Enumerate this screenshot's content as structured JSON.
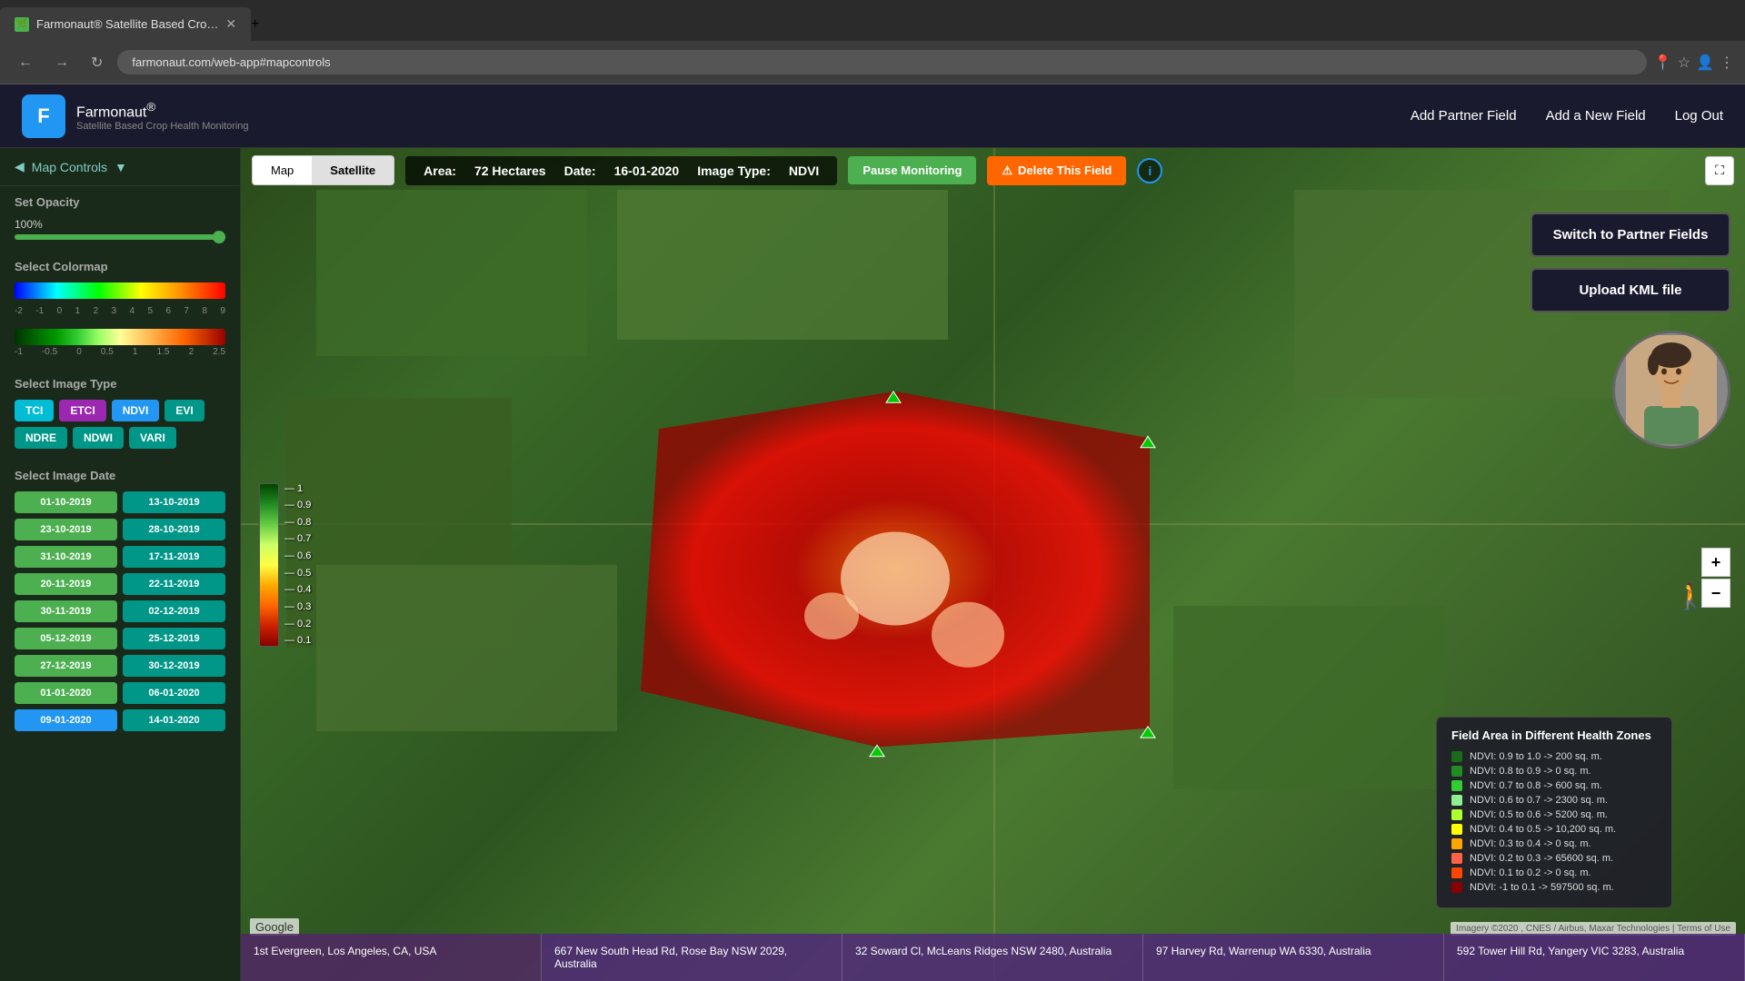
{
  "browser": {
    "tab_title": "Farmonaut® Satellite Based Cro…",
    "url": "farmonaut.com/web-app#mapcontrols",
    "new_tab_label": "+"
  },
  "header": {
    "logo_letter": "F",
    "app_name": "Farmonaut",
    "registered": "®",
    "tagline": "Satellite Based Crop Health Monitoring",
    "add_partner_label": "Add Partner Field",
    "add_field_label": "Add a New Field",
    "logout_label": "Log Out"
  },
  "sidebar": {
    "map_controls_label": "Map Controls",
    "opacity_label": "Set Opacity",
    "opacity_value": "100%",
    "opacity_percent": 100,
    "colormap_label": "Select Colormap",
    "colormap_scale_values": [
      "-2",
      "-1",
      "0",
      "1",
      "2",
      "3",
      "4",
      "5",
      "6",
      "7",
      "8",
      "9"
    ],
    "colormap2_scale_values": [
      "-1",
      "0.5",
      "0",
      "0.5",
      "1",
      "1.5",
      "2",
      "2.5"
    ],
    "image_type_label": "Select Image Type",
    "image_types": [
      {
        "id": "tci",
        "label": "TCI",
        "color": "cyan"
      },
      {
        "id": "etci",
        "label": "ETCI",
        "color": "purple",
        "active": true
      },
      {
        "id": "ndvi",
        "label": "NDVI",
        "color": "blue"
      },
      {
        "id": "evi",
        "label": "EVI",
        "color": "teal"
      },
      {
        "id": "ndre",
        "label": "NDRE",
        "color": "teal"
      },
      {
        "id": "ndwi",
        "label": "NDWI",
        "color": "teal"
      },
      {
        "id": "vari",
        "label": "VARI",
        "color": "teal"
      }
    ],
    "date_label": "Select Image Date",
    "dates": [
      "01-10-2019",
      "13-10-2019",
      "23-10-2019",
      "28-10-2019",
      "31-10-2019",
      "17-11-2019",
      "20-11-2019",
      "22-11-2019",
      "30-11-2019",
      "02-12-2019",
      "05-12-2019",
      "25-12-2019",
      "27-12-2019",
      "30-12-2019",
      "01-01-2020",
      "06-01-2020",
      "09-01-2020",
      "14-01-2020"
    ]
  },
  "map": {
    "type_map": "Map",
    "type_satellite": "Satellite",
    "active_type": "Satellite",
    "area_label": "Area:",
    "area_value": "72 Hectares",
    "date_label": "Date:",
    "date_value": "16-01-2020",
    "image_type_label": "Image Type:",
    "image_type_value": "NDVI",
    "pause_btn": "Pause Monitoring",
    "delete_btn": "Delete This Field",
    "fullscreen_icon": "⛶",
    "google_watermark": "Google",
    "attribution": "Imagery ©2020 , CNES / Airbus, Maxar Technologies | Terms of Use"
  },
  "ndvi_scale": {
    "values": [
      "1",
      "0.9",
      "0.8",
      "0.7",
      "0.6",
      "0.5",
      "0.4",
      "0.3",
      "0.2",
      "0.1"
    ]
  },
  "health_zones": {
    "title": "Field Area in Different Health Zones",
    "rows": [
      {
        "color": "#1a6b1a",
        "label": "NDVI: 0.9 to 1.0 -> 200 sq. m."
      },
      {
        "color": "#228B22",
        "label": "NDVI: 0.8 to 0.9 -> 0 sq. m."
      },
      {
        "color": "#32CD32",
        "label": "NDVI: 0.7 to 0.8 -> 600 sq. m."
      },
      {
        "color": "#90EE90",
        "label": "NDVI: 0.6 to 0.7 -> 2300 sq. m."
      },
      {
        "color": "#ADFF2F",
        "label": "NDVI: 0.5 to 0.6 -> 5200 sq. m."
      },
      {
        "color": "#FFFF00",
        "label": "NDVI: 0.4 to 0.5 -> 10,200 sq. m."
      },
      {
        "color": "#FFA500",
        "label": "NDVI: 0.3 to 0.4 -> 0 sq. m."
      },
      {
        "color": "#FF6347",
        "label": "NDVI: 0.2 to 0.3 -> 65600 sq. m."
      },
      {
        "color": "#FF4500",
        "label": "NDVI: 0.1 to 0.2 -> 0 sq. m."
      },
      {
        "color": "#8B0000",
        "label": "NDVI: -1 to 0.1 -> 597500 sq. m."
      }
    ]
  },
  "right_panel": {
    "switch_btn": "Switch to Partner Fields",
    "upload_btn": "Upload KML file"
  },
  "field_cards": [
    {
      "address": "1st Evergreen, Los Angeles, CA, USA"
    },
    {
      "address": "667 New South Head Rd, Rose Bay NSW 2029, Australia"
    },
    {
      "address": "32 Soward Cl, McLeans Ridges NSW 2480, Australia"
    },
    {
      "address": "97 Harvey Rd, Warrenup WA 6330, Australia"
    },
    {
      "address": "592 Tower Hill Rd, Yangery VIC 3283, Australia"
    }
  ]
}
